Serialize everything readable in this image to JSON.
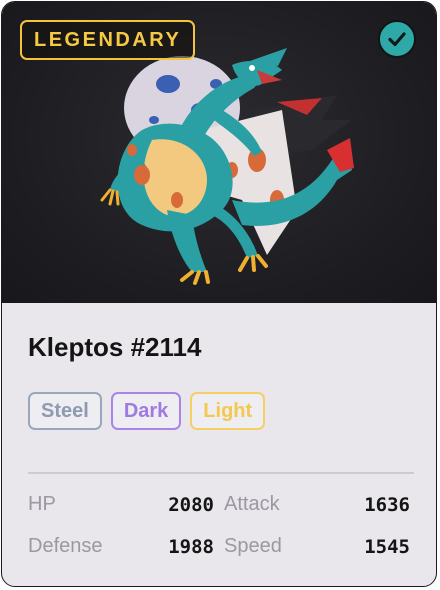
{
  "card": {
    "badge": "LEGENDARY",
    "name": "Kleptos #2114",
    "types": [
      {
        "label": "Steel",
        "color": "#9aa6bb"
      },
      {
        "label": "Dark",
        "color": "#a784e6"
      },
      {
        "label": "Light",
        "color": "#f5cf63"
      }
    ],
    "stats": {
      "hp": {
        "label": "HP",
        "value": "2080"
      },
      "attack": {
        "label": "Attack",
        "value": "1636"
      },
      "defense": {
        "label": "Defense",
        "value": "1988"
      },
      "speed": {
        "label": "Speed",
        "value": "1545"
      }
    }
  },
  "icons": {
    "selected": "checkmark-icon",
    "creature": "dragon-creature-illustration"
  },
  "colors": {
    "badge_gold": "#f4c53b",
    "check_teal": "#2fa8a8",
    "card_bg": "#e9e7ec",
    "art_bg": "#1d1c20"
  }
}
